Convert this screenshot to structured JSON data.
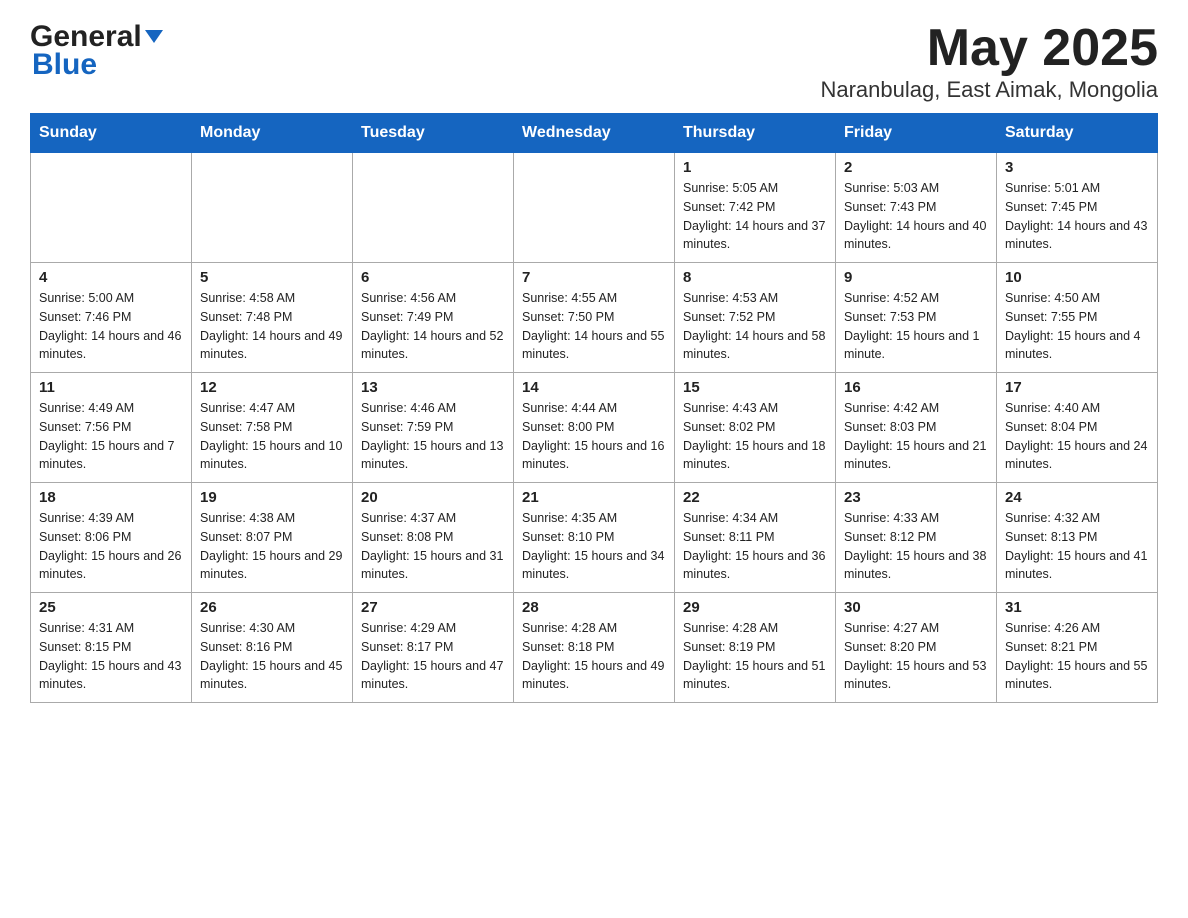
{
  "header": {
    "title": "May 2025",
    "subtitle": "Naranbulag, East Aimak, Mongolia",
    "logo_general": "General",
    "logo_blue": "Blue"
  },
  "days_of_week": [
    "Sunday",
    "Monday",
    "Tuesday",
    "Wednesday",
    "Thursday",
    "Friday",
    "Saturday"
  ],
  "weeks": [
    [
      {
        "day": "",
        "info": ""
      },
      {
        "day": "",
        "info": ""
      },
      {
        "day": "",
        "info": ""
      },
      {
        "day": "",
        "info": ""
      },
      {
        "day": "1",
        "info": "Sunrise: 5:05 AM\nSunset: 7:42 PM\nDaylight: 14 hours and 37 minutes."
      },
      {
        "day": "2",
        "info": "Sunrise: 5:03 AM\nSunset: 7:43 PM\nDaylight: 14 hours and 40 minutes."
      },
      {
        "day": "3",
        "info": "Sunrise: 5:01 AM\nSunset: 7:45 PM\nDaylight: 14 hours and 43 minutes."
      }
    ],
    [
      {
        "day": "4",
        "info": "Sunrise: 5:00 AM\nSunset: 7:46 PM\nDaylight: 14 hours and 46 minutes."
      },
      {
        "day": "5",
        "info": "Sunrise: 4:58 AM\nSunset: 7:48 PM\nDaylight: 14 hours and 49 minutes."
      },
      {
        "day": "6",
        "info": "Sunrise: 4:56 AM\nSunset: 7:49 PM\nDaylight: 14 hours and 52 minutes."
      },
      {
        "day": "7",
        "info": "Sunrise: 4:55 AM\nSunset: 7:50 PM\nDaylight: 14 hours and 55 minutes."
      },
      {
        "day": "8",
        "info": "Sunrise: 4:53 AM\nSunset: 7:52 PM\nDaylight: 14 hours and 58 minutes."
      },
      {
        "day": "9",
        "info": "Sunrise: 4:52 AM\nSunset: 7:53 PM\nDaylight: 15 hours and 1 minute."
      },
      {
        "day": "10",
        "info": "Sunrise: 4:50 AM\nSunset: 7:55 PM\nDaylight: 15 hours and 4 minutes."
      }
    ],
    [
      {
        "day": "11",
        "info": "Sunrise: 4:49 AM\nSunset: 7:56 PM\nDaylight: 15 hours and 7 minutes."
      },
      {
        "day": "12",
        "info": "Sunrise: 4:47 AM\nSunset: 7:58 PM\nDaylight: 15 hours and 10 minutes."
      },
      {
        "day": "13",
        "info": "Sunrise: 4:46 AM\nSunset: 7:59 PM\nDaylight: 15 hours and 13 minutes."
      },
      {
        "day": "14",
        "info": "Sunrise: 4:44 AM\nSunset: 8:00 PM\nDaylight: 15 hours and 16 minutes."
      },
      {
        "day": "15",
        "info": "Sunrise: 4:43 AM\nSunset: 8:02 PM\nDaylight: 15 hours and 18 minutes."
      },
      {
        "day": "16",
        "info": "Sunrise: 4:42 AM\nSunset: 8:03 PM\nDaylight: 15 hours and 21 minutes."
      },
      {
        "day": "17",
        "info": "Sunrise: 4:40 AM\nSunset: 8:04 PM\nDaylight: 15 hours and 24 minutes."
      }
    ],
    [
      {
        "day": "18",
        "info": "Sunrise: 4:39 AM\nSunset: 8:06 PM\nDaylight: 15 hours and 26 minutes."
      },
      {
        "day": "19",
        "info": "Sunrise: 4:38 AM\nSunset: 8:07 PM\nDaylight: 15 hours and 29 minutes."
      },
      {
        "day": "20",
        "info": "Sunrise: 4:37 AM\nSunset: 8:08 PM\nDaylight: 15 hours and 31 minutes."
      },
      {
        "day": "21",
        "info": "Sunrise: 4:35 AM\nSunset: 8:10 PM\nDaylight: 15 hours and 34 minutes."
      },
      {
        "day": "22",
        "info": "Sunrise: 4:34 AM\nSunset: 8:11 PM\nDaylight: 15 hours and 36 minutes."
      },
      {
        "day": "23",
        "info": "Sunrise: 4:33 AM\nSunset: 8:12 PM\nDaylight: 15 hours and 38 minutes."
      },
      {
        "day": "24",
        "info": "Sunrise: 4:32 AM\nSunset: 8:13 PM\nDaylight: 15 hours and 41 minutes."
      }
    ],
    [
      {
        "day": "25",
        "info": "Sunrise: 4:31 AM\nSunset: 8:15 PM\nDaylight: 15 hours and 43 minutes."
      },
      {
        "day": "26",
        "info": "Sunrise: 4:30 AM\nSunset: 8:16 PM\nDaylight: 15 hours and 45 minutes."
      },
      {
        "day": "27",
        "info": "Sunrise: 4:29 AM\nSunset: 8:17 PM\nDaylight: 15 hours and 47 minutes."
      },
      {
        "day": "28",
        "info": "Sunrise: 4:28 AM\nSunset: 8:18 PM\nDaylight: 15 hours and 49 minutes."
      },
      {
        "day": "29",
        "info": "Sunrise: 4:28 AM\nSunset: 8:19 PM\nDaylight: 15 hours and 51 minutes."
      },
      {
        "day": "30",
        "info": "Sunrise: 4:27 AM\nSunset: 8:20 PM\nDaylight: 15 hours and 53 minutes."
      },
      {
        "day": "31",
        "info": "Sunrise: 4:26 AM\nSunset: 8:21 PM\nDaylight: 15 hours and 55 minutes."
      }
    ]
  ]
}
